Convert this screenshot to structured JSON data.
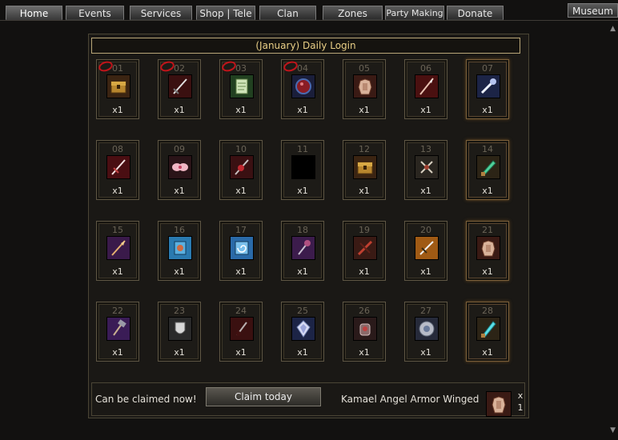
{
  "nav": {
    "tabs": [
      "Home",
      "Events",
      "Services",
      "Shop | Tele",
      "Clan",
      "Zones",
      "Party Making",
      "Donate"
    ],
    "museum": "Museum"
  },
  "calendar": {
    "title": "(January) Daily Login",
    "days": [
      {
        "day": "01",
        "qty": "x1",
        "icon": "treasure-chest-icon",
        "claimed": true
      },
      {
        "day": "02",
        "qty": "x1",
        "icon": "dark-sword-icon",
        "claimed": true
      },
      {
        "day": "03",
        "qty": "x1",
        "icon": "scroll-icon",
        "claimed": true
      },
      {
        "day": "04",
        "qty": "x1",
        "icon": "red-crystal-orb-icon",
        "claimed": true
      },
      {
        "day": "05",
        "qty": "x1",
        "icon": "armor-icon",
        "claimed": false
      },
      {
        "day": "06",
        "qty": "x1",
        "icon": "red-spear-icon",
        "claimed": false
      },
      {
        "day": "07",
        "qty": "x1",
        "icon": "silver-weapon-icon",
        "claimed": false
      },
      {
        "day": "08",
        "qty": "x1",
        "icon": "red-sword-icon",
        "claimed": false
      },
      {
        "day": "09",
        "qty": "x1",
        "icon": "pink-wings-icon",
        "claimed": false
      },
      {
        "day": "10",
        "qty": "x1",
        "icon": "red-staff-icon",
        "claimed": false
      },
      {
        "day": "11",
        "qty": "x1",
        "icon": "empty-black-icon",
        "claimed": false
      },
      {
        "day": "12",
        "qty": "x1",
        "icon": "treasure-chest-icon",
        "claimed": false
      },
      {
        "day": "13",
        "qty": "x1",
        "icon": "twin-axes-icon",
        "claimed": false
      },
      {
        "day": "14",
        "qty": "x1",
        "icon": "emerald-blade-icon",
        "claimed": false
      },
      {
        "day": "15",
        "qty": "x1",
        "icon": "purple-spear-icon",
        "claimed": false
      },
      {
        "day": "16",
        "qty": "x1",
        "icon": "blue-scroll-icon",
        "claimed": false
      },
      {
        "day": "17",
        "qty": "x1",
        "icon": "spiral-scroll-icon",
        "claimed": false
      },
      {
        "day": "18",
        "qty": "x1",
        "icon": "purple-mace-icon",
        "claimed": false
      },
      {
        "day": "19",
        "qty": "x1",
        "icon": "crossbow-icon",
        "claimed": false
      },
      {
        "day": "20",
        "qty": "x1",
        "icon": "gold-sword-icon",
        "claimed": false
      },
      {
        "day": "21",
        "qty": "x1",
        "icon": "armor-icon",
        "claimed": false
      },
      {
        "day": "22",
        "qty": "x1",
        "icon": "purple-hammer-icon",
        "claimed": false
      },
      {
        "day": "23",
        "qty": "x1",
        "icon": "silver-shield-icon",
        "claimed": false
      },
      {
        "day": "24",
        "qty": "x1",
        "icon": "dark-dagger-icon",
        "claimed": false
      },
      {
        "day": "25",
        "qty": "x1",
        "icon": "silver-crystal-icon",
        "claimed": false
      },
      {
        "day": "26",
        "qty": "x1",
        "icon": "gauntlet-icon",
        "claimed": false
      },
      {
        "day": "27",
        "qty": "x1",
        "icon": "gem-orb-icon",
        "claimed": false
      },
      {
        "day": "28",
        "qty": "x1",
        "icon": "cyan-sword-icon",
        "claimed": false
      }
    ]
  },
  "claim": {
    "status": "Can be claimed now!",
    "button": "Claim today",
    "reward_name": "Kamael Angel Armor Winged",
    "reward_qty": "x 1",
    "reward_icon": "armor-icon"
  },
  "colors": {
    "title_text": "#e9cf86",
    "claimed_mark": "#c0141a"
  }
}
